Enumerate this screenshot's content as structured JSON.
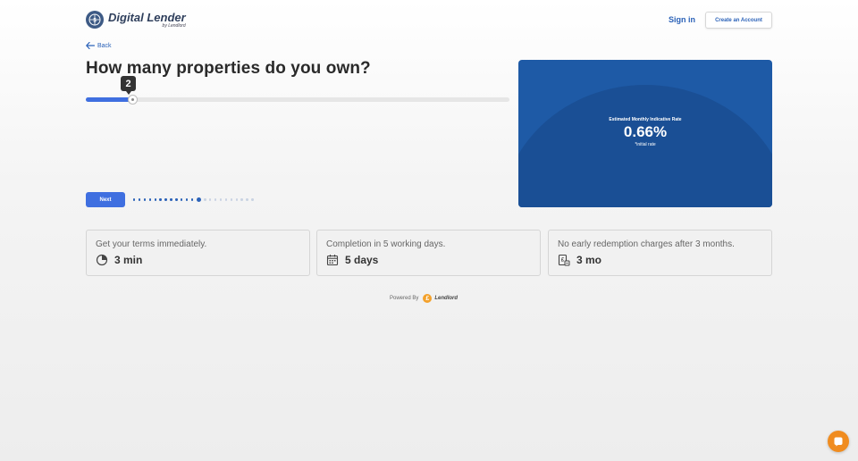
{
  "header": {
    "logo_title": "Digital Lender",
    "logo_subtitle": "by Lendlord",
    "signin_label": "Sign in",
    "create_account_label": "Create an Account"
  },
  "back_label": "Back",
  "question": "How many properties do you own?",
  "slider": {
    "value": "2",
    "fraction": 0.11
  },
  "next_label": "Next",
  "progress": {
    "total_steps": 23,
    "current_step": 13
  },
  "rate_card": {
    "label": "Estimated Monthly Indicative Rate",
    "value": "0.66%",
    "note": "*initial rate"
  },
  "features": [
    {
      "title": "Get your terms immediately.",
      "value": "3 min",
      "icon": "clock-icon"
    },
    {
      "title": "Completion in 5 working days.",
      "value": "5 days",
      "icon": "calendar-icon"
    },
    {
      "title": "No early redemption charges after 3 months.",
      "value": "3 mo",
      "icon": "pound-document-icon"
    }
  ],
  "powered": {
    "label": "Powered By",
    "coin": "£",
    "brand": "Lendlord"
  },
  "colors": {
    "accent": "#3f6fe0",
    "link": "#2b62b8",
    "card": "#1e5aa6",
    "chat": "#f08c1f"
  }
}
